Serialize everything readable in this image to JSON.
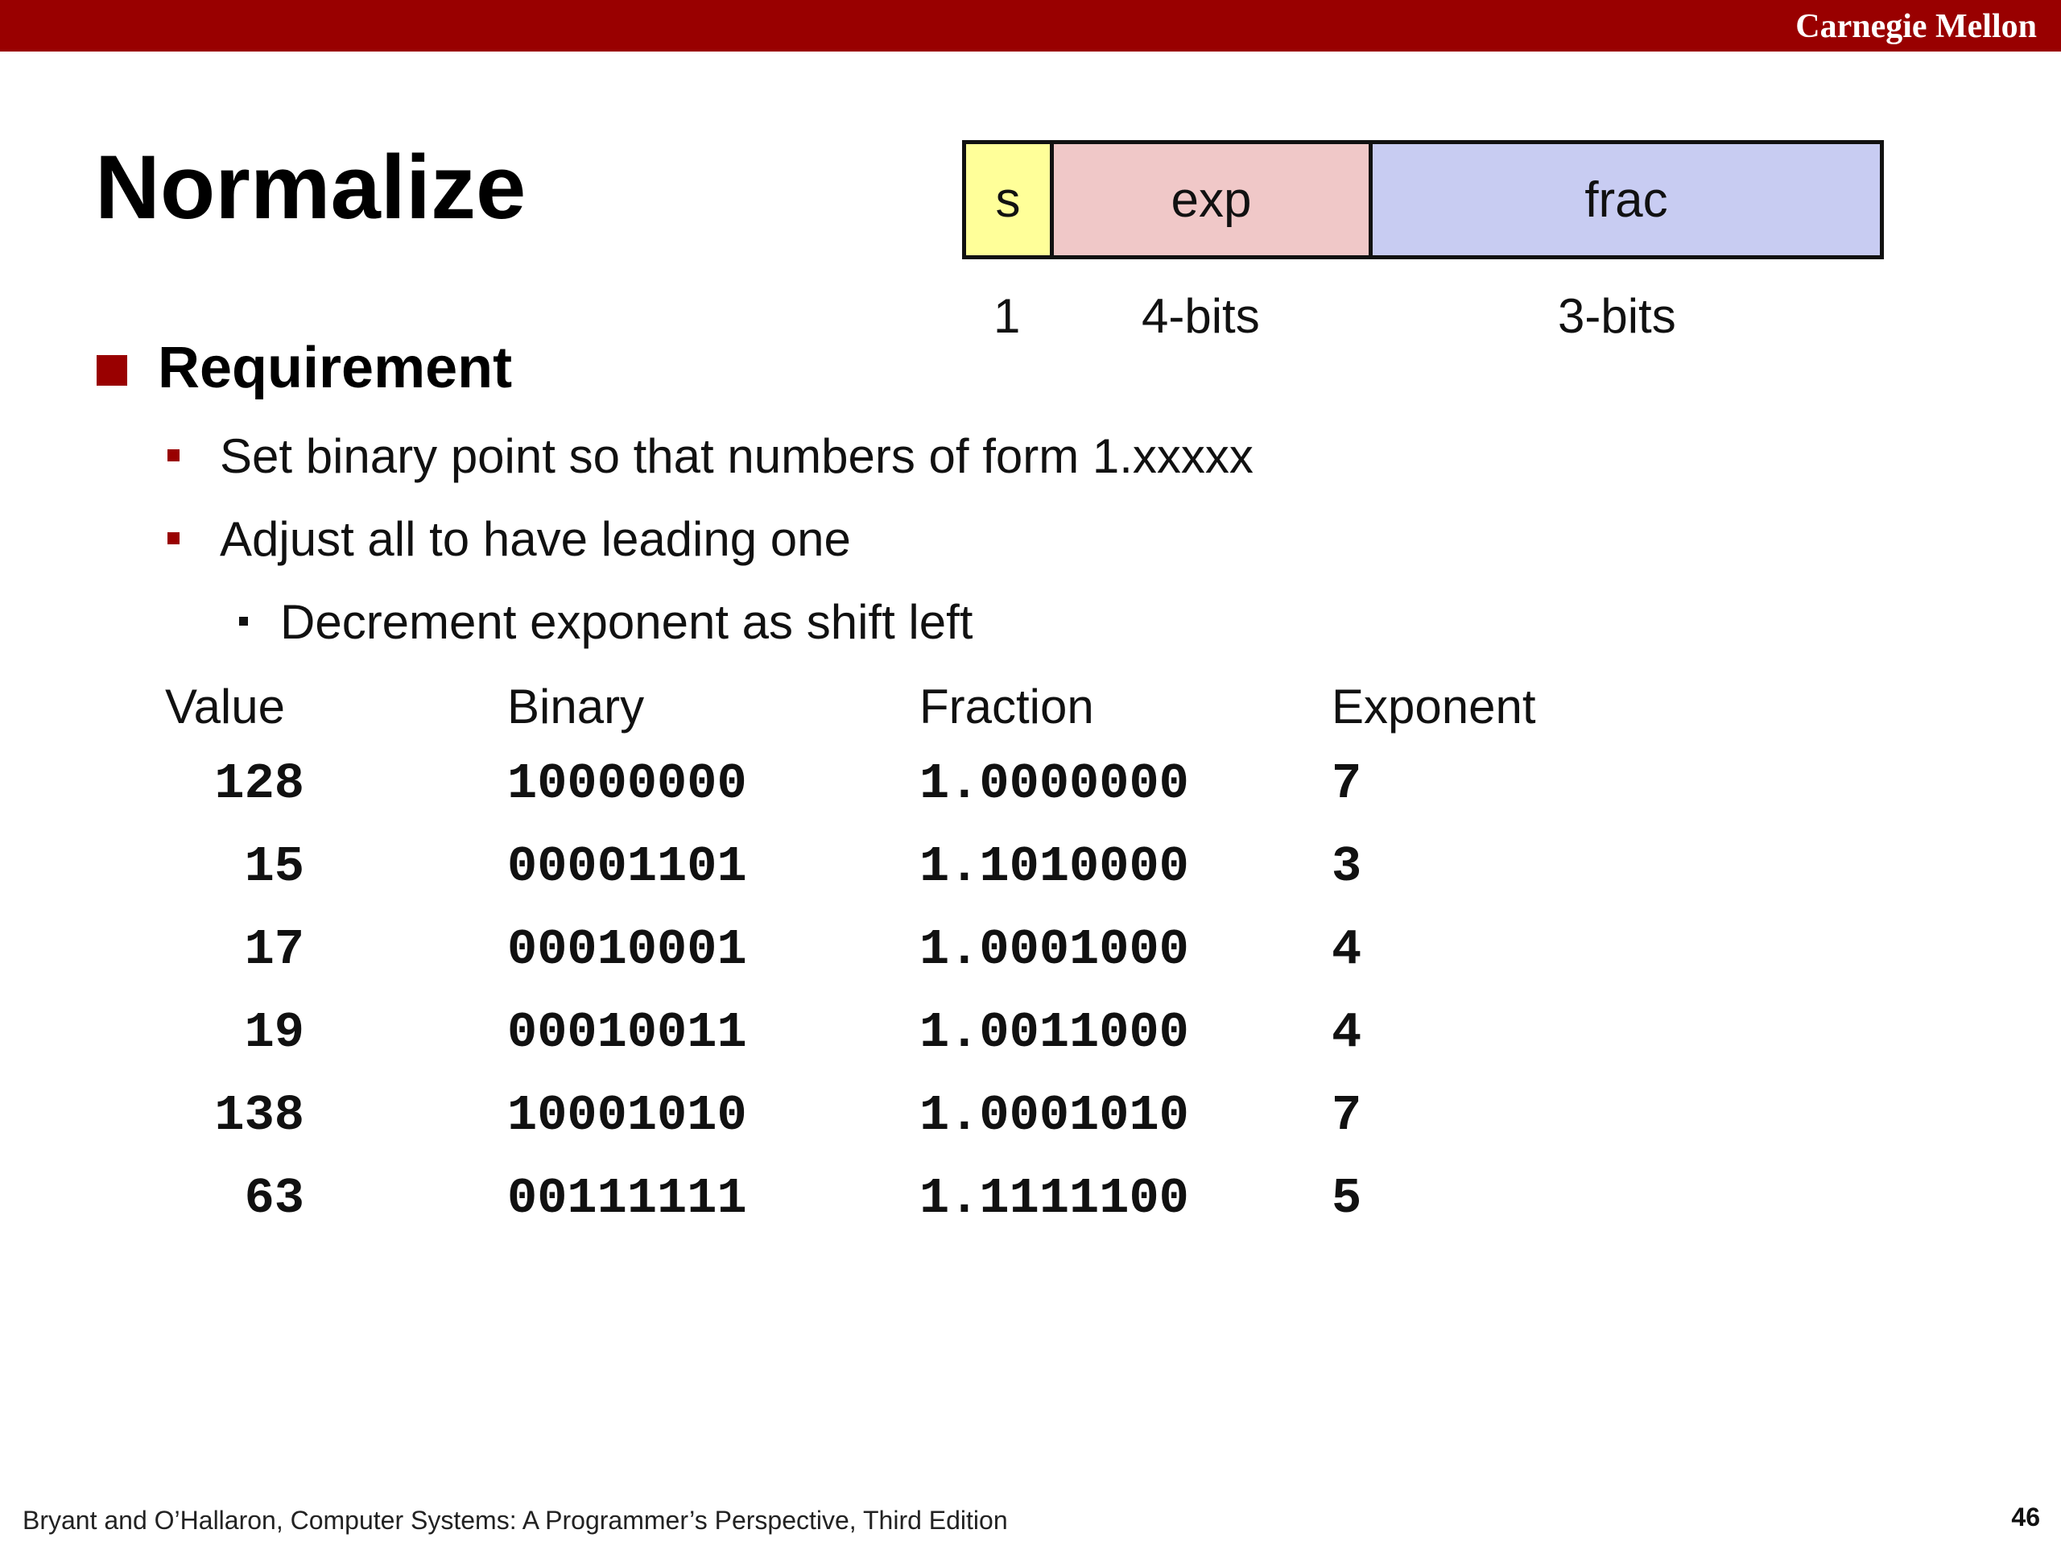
{
  "header": {
    "brand": "Carnegie Mellon"
  },
  "title": "Normalize",
  "format": {
    "fields": [
      "s",
      "exp",
      "frac"
    ],
    "widths": [
      "1",
      "4-bits",
      "3-bits"
    ],
    "colors": {
      "s": "#ffff99",
      "exp": "#f0c8c8",
      "frac": "#c8ccf2"
    }
  },
  "bullets": {
    "level1": "Requirement",
    "level2": [
      "Set binary point so that numbers of form 1.xxxxx",
      "Adjust all to have leading one"
    ],
    "level3": "Decrement exponent as shift left"
  },
  "table": {
    "headers": [
      "Value",
      "Binary",
      "Fraction",
      "Exponent"
    ],
    "rows": [
      [
        "128",
        "10000000",
        "1.0000000",
        "7"
      ],
      [
        "15",
        "00001101",
        "1.1010000",
        "3"
      ],
      [
        "17",
        "00010001",
        "1.0001000",
        "4"
      ],
      [
        "19",
        "00010011",
        "1.0011000",
        "4"
      ],
      [
        "138",
        "10001010",
        "1.0001010",
        "7"
      ],
      [
        "63",
        "00111111",
        "1.1111100",
        "5"
      ]
    ]
  },
  "footer": {
    "citation": "Bryant and O’Hallaron, Computer Systems: A Programmer’s Perspective, Third Edition",
    "page": "46"
  },
  "accent_color": "#990000"
}
